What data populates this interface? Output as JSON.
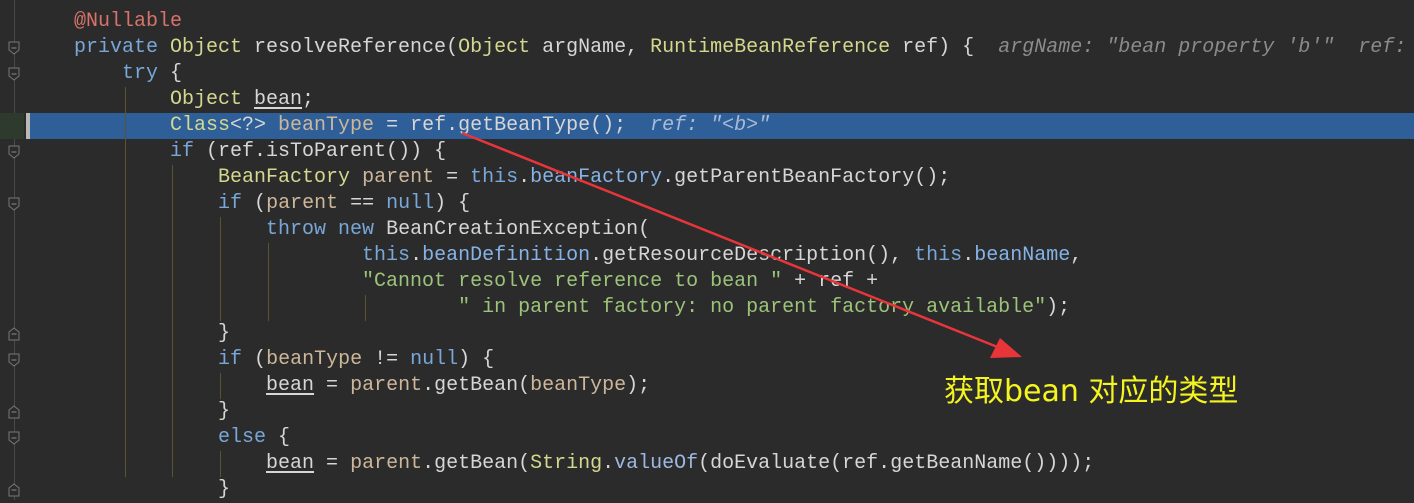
{
  "editor": {
    "language": "java",
    "selected_line": 4,
    "lines": [
      [
        [
          "ann",
          "@Nullable"
        ]
      ],
      [
        [
          "kw",
          "private "
        ],
        [
          "type",
          "Object "
        ],
        [
          "plain",
          "resolveReference("
        ],
        [
          "type",
          "Object "
        ],
        [
          "plain",
          "argName, "
        ],
        [
          "type",
          "RuntimeBeanReference "
        ],
        [
          "plain",
          "ref) {"
        ],
        [
          "hint",
          "  argName: \"bean property 'b'\"  ref: "
        ]
      ],
      [
        [
          "plain",
          "    "
        ],
        [
          "kw",
          "try "
        ],
        [
          "plain",
          "{"
        ]
      ],
      [
        [
          "plain",
          "        "
        ],
        [
          "type",
          "Object "
        ],
        [
          "uvar",
          "bean"
        ],
        [
          "plain",
          ";"
        ]
      ],
      [
        [
          "plain",
          "        "
        ],
        [
          "type",
          "Class"
        ],
        [
          "plain",
          "<?> "
        ],
        [
          "var",
          "beanType"
        ],
        [
          "plain",
          " = ref.getBeanType();"
        ],
        [
          "hint",
          "  ref: \"<b>\""
        ]
      ],
      [
        [
          "plain",
          "        "
        ],
        [
          "kw",
          "if "
        ],
        [
          "plain",
          "(ref.isToParent()) {"
        ]
      ],
      [
        [
          "plain",
          "            "
        ],
        [
          "type",
          "BeanFactory "
        ],
        [
          "var",
          "parent"
        ],
        [
          "plain",
          " = "
        ],
        [
          "kw",
          "this"
        ],
        [
          "plain",
          "."
        ],
        [
          "field",
          "beanFactory"
        ],
        [
          "plain",
          ".getParentBeanFactory();"
        ]
      ],
      [
        [
          "plain",
          "            "
        ],
        [
          "kw",
          "if "
        ],
        [
          "plain",
          "("
        ],
        [
          "var",
          "parent"
        ],
        [
          "plain",
          " == "
        ],
        [
          "kw",
          "null"
        ],
        [
          "plain",
          ") {"
        ]
      ],
      [
        [
          "plain",
          "                "
        ],
        [
          "kw",
          "throw new "
        ],
        [
          "plain",
          "BeanCreationException("
        ]
      ],
      [
        [
          "plain",
          "                        "
        ],
        [
          "kw",
          "this"
        ],
        [
          "plain",
          "."
        ],
        [
          "field",
          "beanDefinition"
        ],
        [
          "plain",
          ".getResourceDescription(), "
        ],
        [
          "kw",
          "this"
        ],
        [
          "plain",
          "."
        ],
        [
          "field",
          "beanName"
        ],
        [
          "plain",
          ","
        ]
      ],
      [
        [
          "plain",
          "                        "
        ],
        [
          "str",
          "\"Cannot resolve reference to bean \""
        ],
        [
          "plain",
          " + ref +"
        ]
      ],
      [
        [
          "plain",
          "                                "
        ],
        [
          "str",
          "\" in parent factory: no parent factory available\""
        ],
        [
          "plain",
          ");"
        ]
      ],
      [
        [
          "plain",
          "            }"
        ]
      ],
      [
        [
          "plain",
          "            "
        ],
        [
          "kw",
          "if "
        ],
        [
          "plain",
          "("
        ],
        [
          "var",
          "beanType"
        ],
        [
          "plain",
          " != "
        ],
        [
          "kw",
          "null"
        ],
        [
          "plain",
          ") {"
        ]
      ],
      [
        [
          "plain",
          "                "
        ],
        [
          "uvar",
          "bean"
        ],
        [
          "plain",
          " = "
        ],
        [
          "var",
          "parent"
        ],
        [
          "plain",
          ".getBean("
        ],
        [
          "var",
          "beanType"
        ],
        [
          "plain",
          ");"
        ]
      ],
      [
        [
          "plain",
          "            }"
        ]
      ],
      [
        [
          "plain",
          "            "
        ],
        [
          "kw",
          "else "
        ],
        [
          "plain",
          "{"
        ]
      ],
      [
        [
          "plain",
          "                "
        ],
        [
          "uvar",
          "bean"
        ],
        [
          "plain",
          " = "
        ],
        [
          "var",
          "parent"
        ],
        [
          "plain",
          ".getBean("
        ],
        [
          "type",
          "String"
        ],
        [
          "plain",
          "."
        ],
        [
          "static",
          "valueOf"
        ],
        [
          "plain",
          "(doEvaluate(ref.getBeanName())));"
        ]
      ],
      [
        [
          "plain",
          "            }"
        ]
      ]
    ]
  },
  "annotation": {
    "text": "获取bean 对应的类型",
    "text_color": "#f4f41e",
    "arrow_color": "#e8353a"
  },
  "colors": {
    "background": "#2b2b2b",
    "selection": "#2f5f98"
  }
}
